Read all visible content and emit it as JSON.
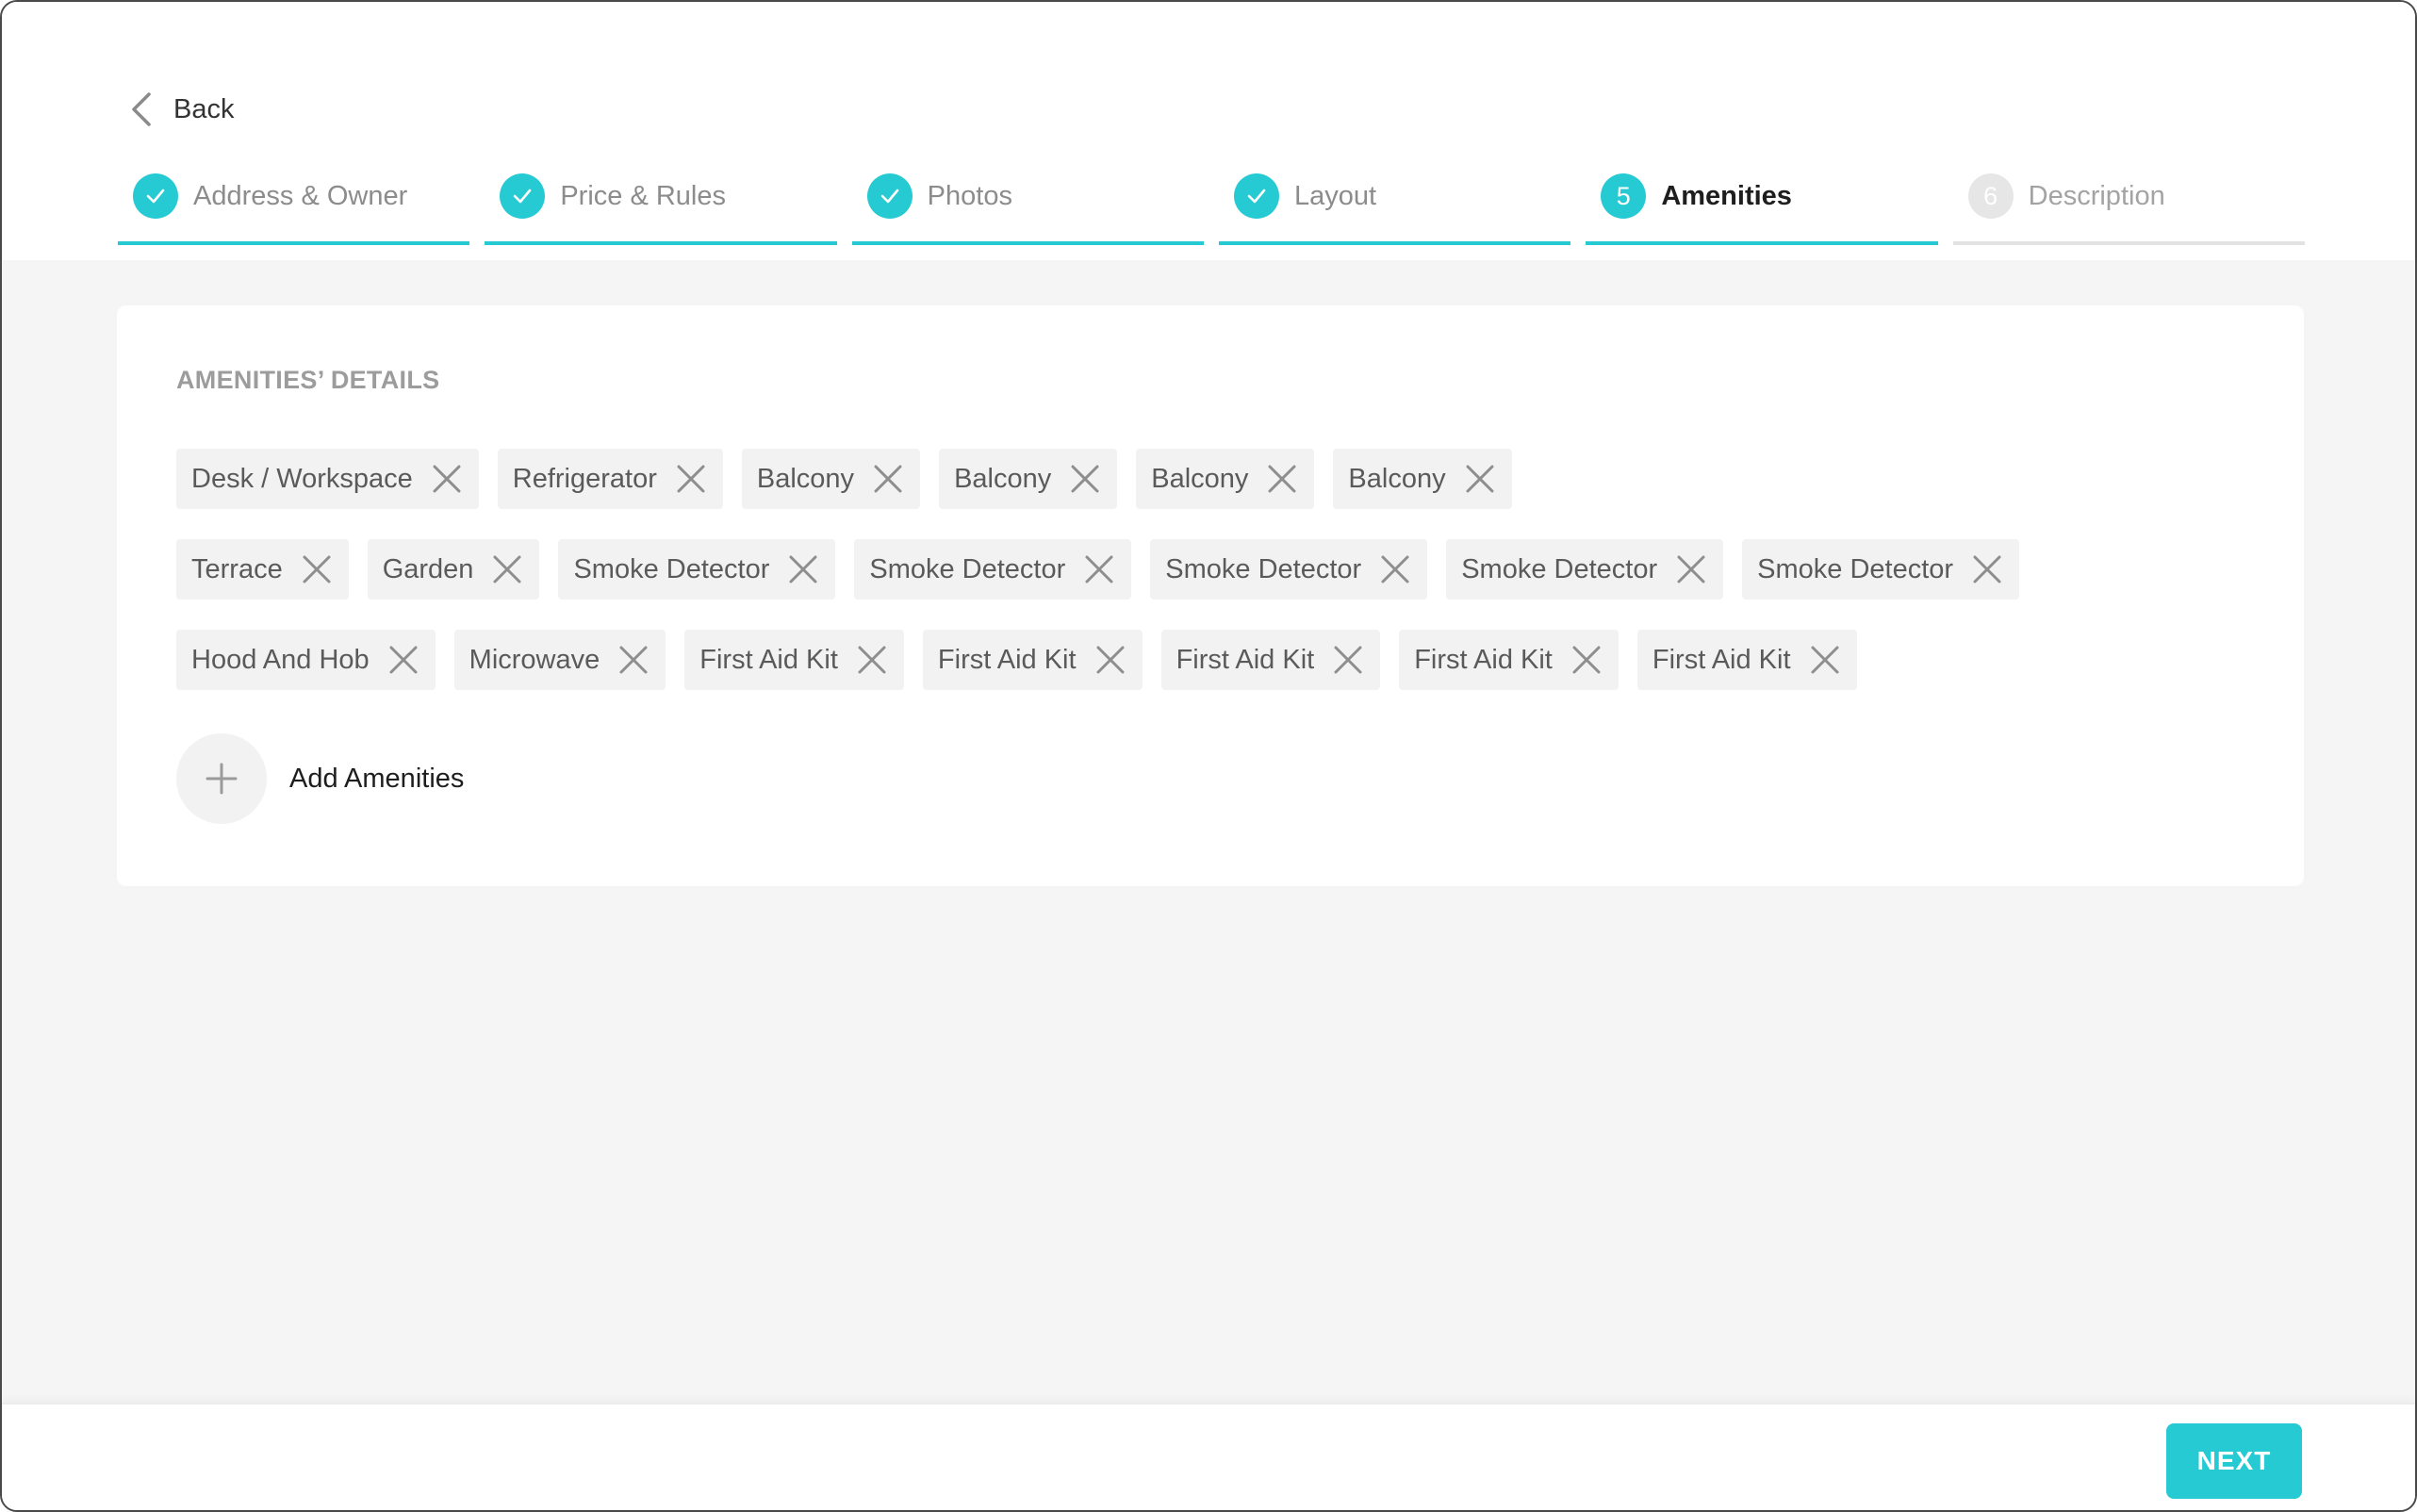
{
  "header": {
    "back_label": "Back"
  },
  "steps": [
    {
      "label": "Address & Owner",
      "state": "done",
      "marker": ""
    },
    {
      "label": "Price & Rules",
      "state": "done",
      "marker": ""
    },
    {
      "label": "Photos",
      "state": "done",
      "marker": ""
    },
    {
      "label": "Layout",
      "state": "done",
      "marker": ""
    },
    {
      "label": "Amenities",
      "state": "active",
      "marker": "5"
    },
    {
      "label": "Description",
      "state": "pending",
      "marker": "6"
    }
  ],
  "amenities": {
    "title": "AMENITIES’ DETAILS",
    "rows": [
      [
        "Desk / Workspace",
        "Refrigerator",
        "Balcony",
        "Balcony",
        "Balcony",
        "Balcony"
      ],
      [
        "Terrace",
        "Garden",
        "Smoke Detector",
        "Smoke Detector",
        "Smoke Detector",
        "Smoke Detector",
        "Smoke Detector"
      ],
      [
        "Hood And Hob",
        "Microwave",
        "First Aid Kit",
        "First Aid Kit",
        "First Aid Kit",
        "First Aid Kit",
        "First Aid Kit"
      ]
    ],
    "add_label": "Add Amenities"
  },
  "footer": {
    "next_label": "NEXT"
  },
  "colors": {
    "accent": "#26cad3",
    "chip_bg": "#f2f2f2",
    "page_bg": "#f5f5f5"
  }
}
